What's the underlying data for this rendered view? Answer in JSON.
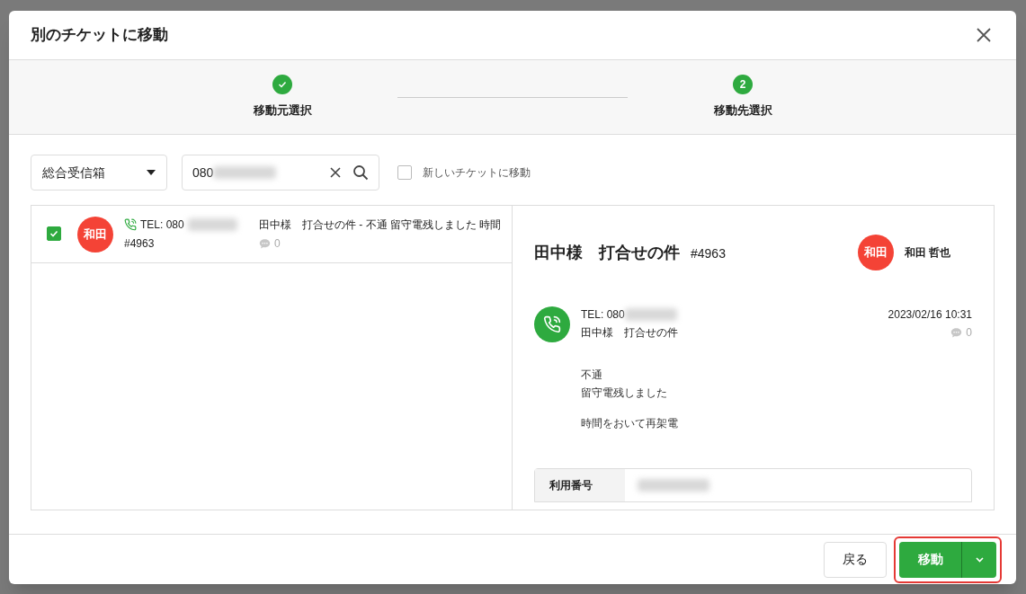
{
  "dialog": {
    "title": "別のチケットに移動"
  },
  "steps": [
    {
      "label": "移動元選択",
      "done": true
    },
    {
      "label": "移動先選択",
      "number": "2",
      "done": false
    }
  ],
  "filters": {
    "inbox": "総合受信箱",
    "search_value": "080",
    "new_ticket": {
      "label": "新しいチケットに移動",
      "checked": false
    }
  },
  "tickets": [
    {
      "checked": true,
      "avatar": "和田",
      "color": "#f44336",
      "tel": "TEL: 080",
      "number": "#4963",
      "subject": "田中様　打合せの件  - 不通 留守電残しました 時間",
      "comments": "0"
    }
  ],
  "detail": {
    "title": "田中様　打合せの件",
    "number": "#4963",
    "assignee_avatar": "和田",
    "assignee": "和田 哲也",
    "message": {
      "tel": "TEL: 080",
      "subject": "田中様　打合せの件",
      "datetime": "2023/02/16 10:31",
      "comments": "0",
      "paragraphs": [
        [
          "不通",
          "留守電残しました"
        ],
        [
          "時間をおいて再架電"
        ]
      ]
    },
    "fields": [
      {
        "label": "利用番号"
      }
    ]
  },
  "footer": {
    "back": "戻る",
    "move": "移動"
  }
}
